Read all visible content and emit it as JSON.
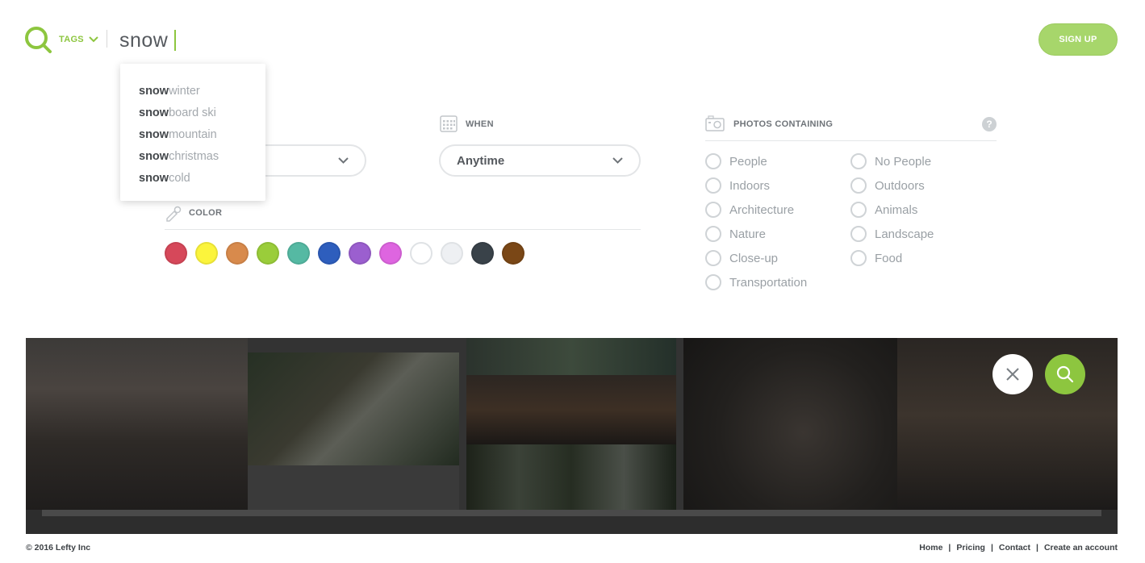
{
  "header": {
    "tags_label": "TAGS",
    "search_value": "snow",
    "signup_label": "SIGN UP"
  },
  "suggestions": [
    {
      "match": "snow",
      "rest": " winter"
    },
    {
      "match": "snow",
      "rest": "board ski"
    },
    {
      "match": "snow",
      "rest": " mountain"
    },
    {
      "match": "snow",
      "rest": " christmas"
    },
    {
      "match": "snow",
      "rest": " cold"
    }
  ],
  "filters": {
    "when_label": "WHEN",
    "when_value": "Anytime",
    "color_label": "COLOR",
    "colors": [
      "#d6485a",
      "#fbf43c",
      "#d88a4c",
      "#9acd3a",
      "#55b9a3",
      "#2e5ebd",
      "#9b5fcf",
      "#de65e0",
      "#ffffff",
      "#eef0f3",
      "#394249",
      "#7a4716"
    ],
    "photos_label": "PHOTOS CONTAINING",
    "photos_left": [
      "People",
      "Indoors",
      "Architecture",
      "Nature",
      "Close-up",
      "Transportation"
    ],
    "photos_right": [
      "No People",
      "Outdoors",
      "Animals",
      "Landscape",
      "Food"
    ]
  },
  "accent_color": "#8dc63f",
  "footer": {
    "copyright": "© 2016 Lefty Inc",
    "links": [
      "Home",
      "Pricing",
      "Contact",
      "Create an account"
    ]
  }
}
